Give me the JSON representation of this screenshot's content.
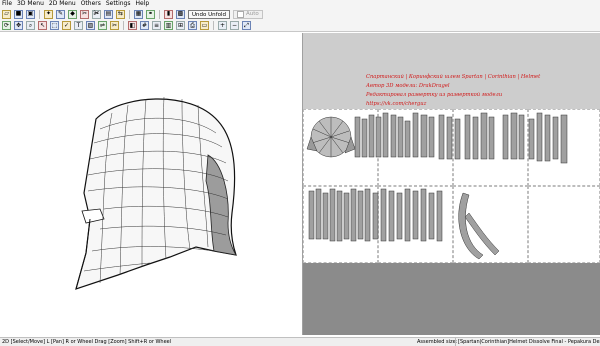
{
  "menu": {
    "items": [
      "File",
      "3D Menu",
      "2D Menu",
      "Others",
      "Settings",
      "Help"
    ]
  },
  "toolbar": {
    "undo_unfold_label": "Undo Unfold",
    "auto_label": "Auto"
  },
  "annotation": {
    "lines": [
      "Спартанский | Коринфский шлем Spartan | Corinthian | Helmet",
      "Автор 3D модели: DrakDragel",
      "Редактировал развертку из разверткой модели",
      "https://vk.com/cherguz"
    ],
    "color": "#d11818"
  },
  "status": {
    "hint": "2D [Select/Move] L [Pan] R or Wheel Drag [Zoom] Shift+R or Wheel",
    "state": "Assembled size:",
    "title": "[Spartan|Corinthian]Helmet Dissolve Final - Pepakura Designer 4"
  },
  "colors": {
    "background": "#ffffff",
    "canvas2d": "#8b8b8b",
    "status_bg": "#efefef"
  }
}
